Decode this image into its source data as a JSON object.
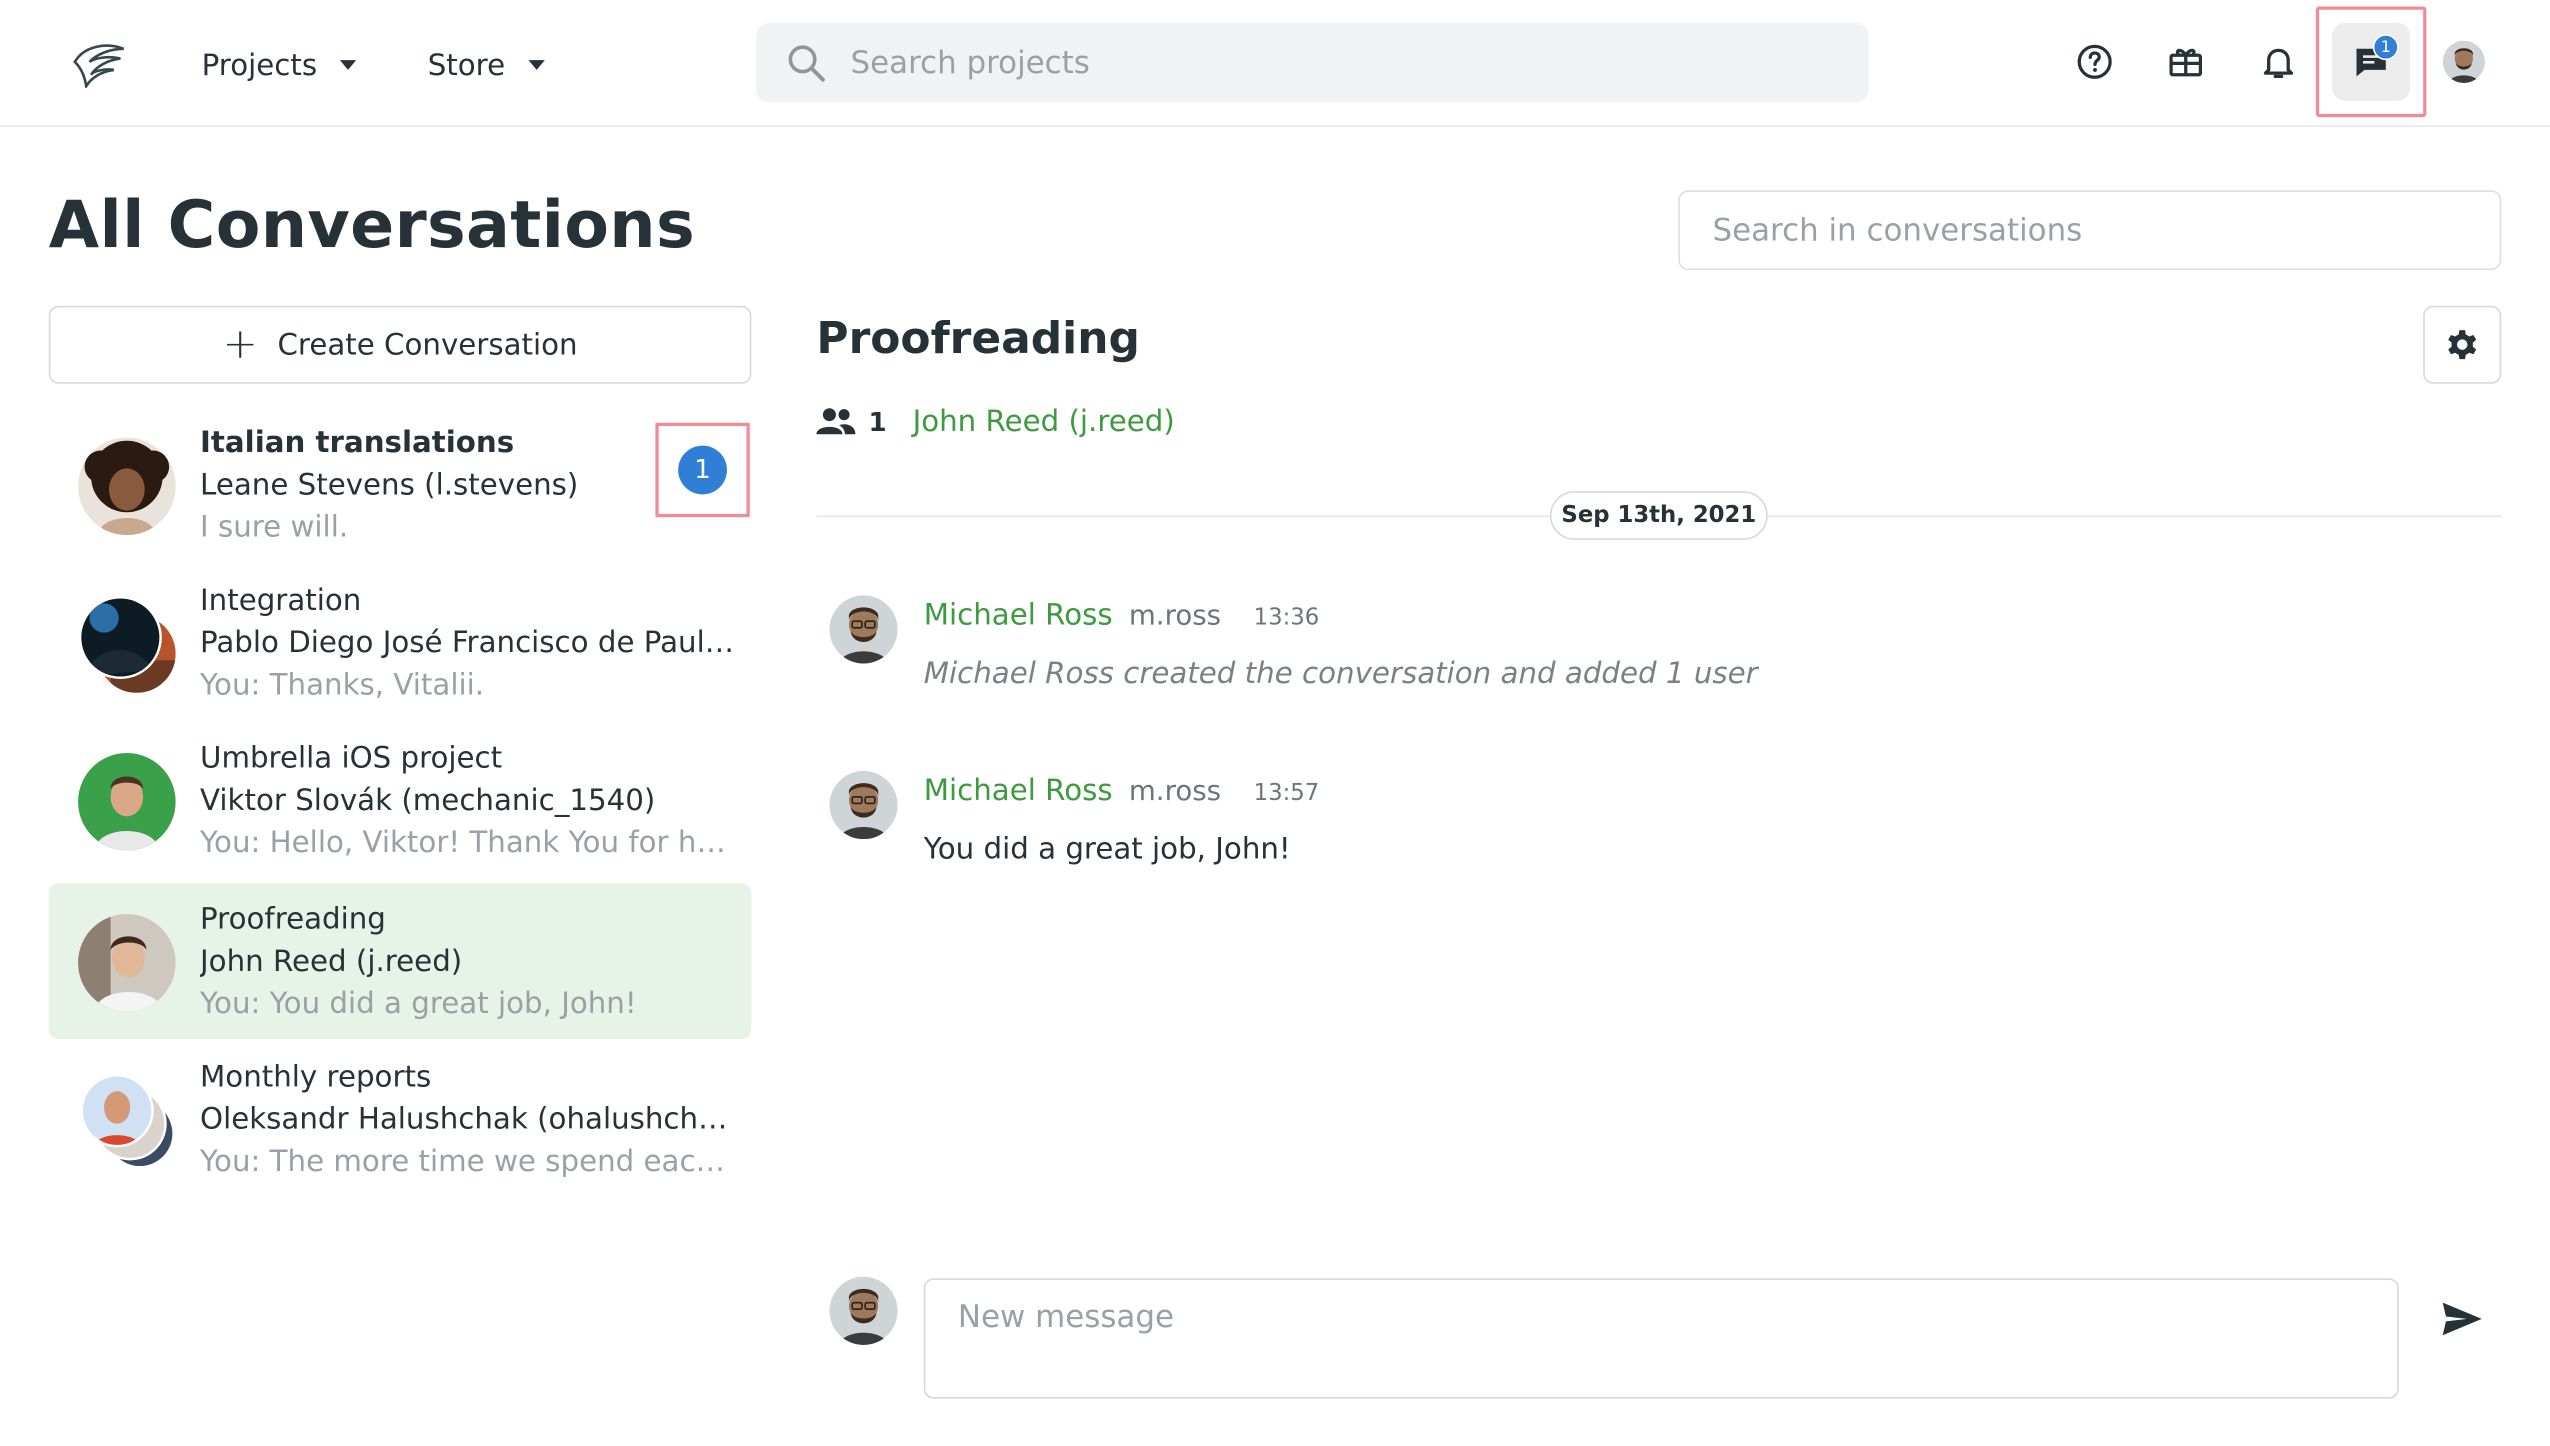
{
  "topbar": {
    "nav": [
      {
        "label": "Projects"
      },
      {
        "label": "Store"
      }
    ],
    "search_placeholder": "Search projects",
    "icons": [
      "logo-icon",
      "help-icon",
      "gift-icon",
      "bell-icon",
      "messages-icon"
    ],
    "messages_badge": "1"
  },
  "page": {
    "title": "All Conversations",
    "conv_search_placeholder": "Search in conversations",
    "create_label": "Create Conversation"
  },
  "conversations": [
    {
      "title": "Italian translations",
      "participants": "Leane Stevens (l.stevens)",
      "last": "I sure will.",
      "unread": "1",
      "bold": true
    },
    {
      "title": "Integration",
      "participants": "Pablo Diego José Francisco de Paula ...",
      "last": "You: Thanks, Vitalii."
    },
    {
      "title": "Umbrella iOS project",
      "participants": "Viktor Slovák (mechanic_1540)",
      "last": "You: Hello, Viktor! Thank You for helpi..."
    },
    {
      "title": "Proofreading",
      "participants": "John Reed (j.reed)",
      "last": "You: You did a great job, John!",
      "active": true
    },
    {
      "title": "Monthly reports",
      "participants": "Oleksandr Halushchak (ohalushcha), ...",
      "last": "You: The more time we spend each m..."
    }
  ],
  "chat": {
    "title": "Proofreading",
    "member_count": "1",
    "member_name": "John Reed (j.reed)",
    "date": "Sep 13th, 2021",
    "messages": [
      {
        "name": "Michael Ross",
        "user": "m.ross",
        "time": "13:36",
        "text": "Michael Ross created the conversation and added 1 user",
        "system": true
      },
      {
        "name": "Michael Ross",
        "user": "m.ross",
        "time": "13:57",
        "text": "You did a great job, John!"
      }
    ],
    "compose_placeholder": "New message"
  },
  "colors": {
    "accent_green": "#3e9a3e",
    "active_bg": "#e7f3e6",
    "badge_blue": "#2f7fd6",
    "highlight_red": "#f28b94"
  }
}
